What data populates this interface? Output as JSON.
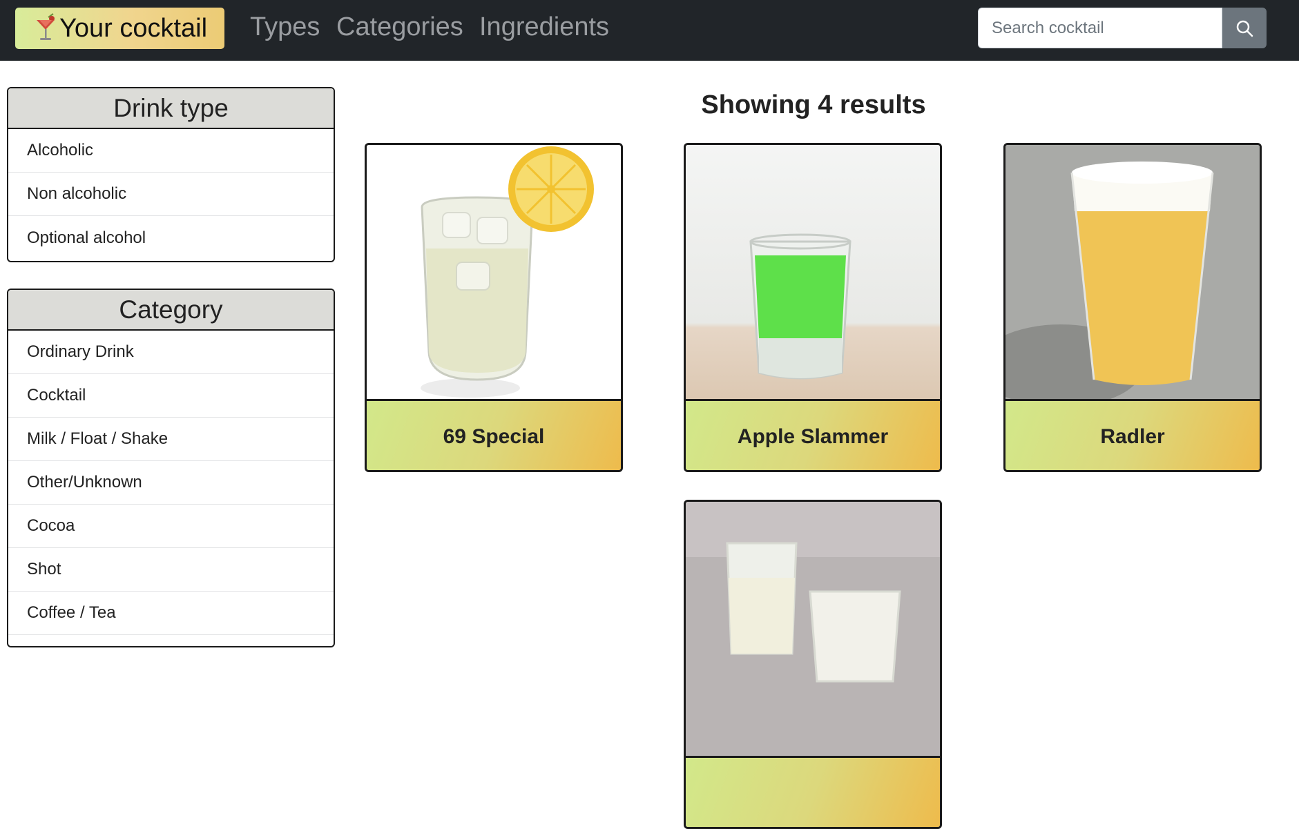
{
  "navbar": {
    "brand": "Your cocktail",
    "links": [
      "Types",
      "Categories",
      "Ingredients"
    ],
    "search": {
      "placeholder": "Search cocktail",
      "value": ""
    }
  },
  "sidebar": {
    "drink_type": {
      "title": "Drink type",
      "items": [
        "Alcoholic",
        "Non alcoholic",
        "Optional alcohol"
      ]
    },
    "category": {
      "title": "Category",
      "items": [
        "Ordinary Drink",
        "Cocktail",
        "Milk / Float / Shake",
        "Other/Unknown",
        "Cocoa",
        "Shot",
        "Coffee / Tea"
      ]
    }
  },
  "results": {
    "title": "Showing 4 results",
    "cards": [
      {
        "name": "69 Special"
      },
      {
        "name": "Apple Slammer"
      },
      {
        "name": "Radler"
      },
      {
        "name": ""
      }
    ]
  },
  "colors": {
    "navbar_bg": "#212529",
    "brand_gradient": [
      "#d8ec9a",
      "#eccb75"
    ],
    "card_label_gradient": [
      "#d2e88a",
      "#eebb4c"
    ],
    "search_button": "#6c757d",
    "panel_header_bg": "#dcdcd8"
  }
}
